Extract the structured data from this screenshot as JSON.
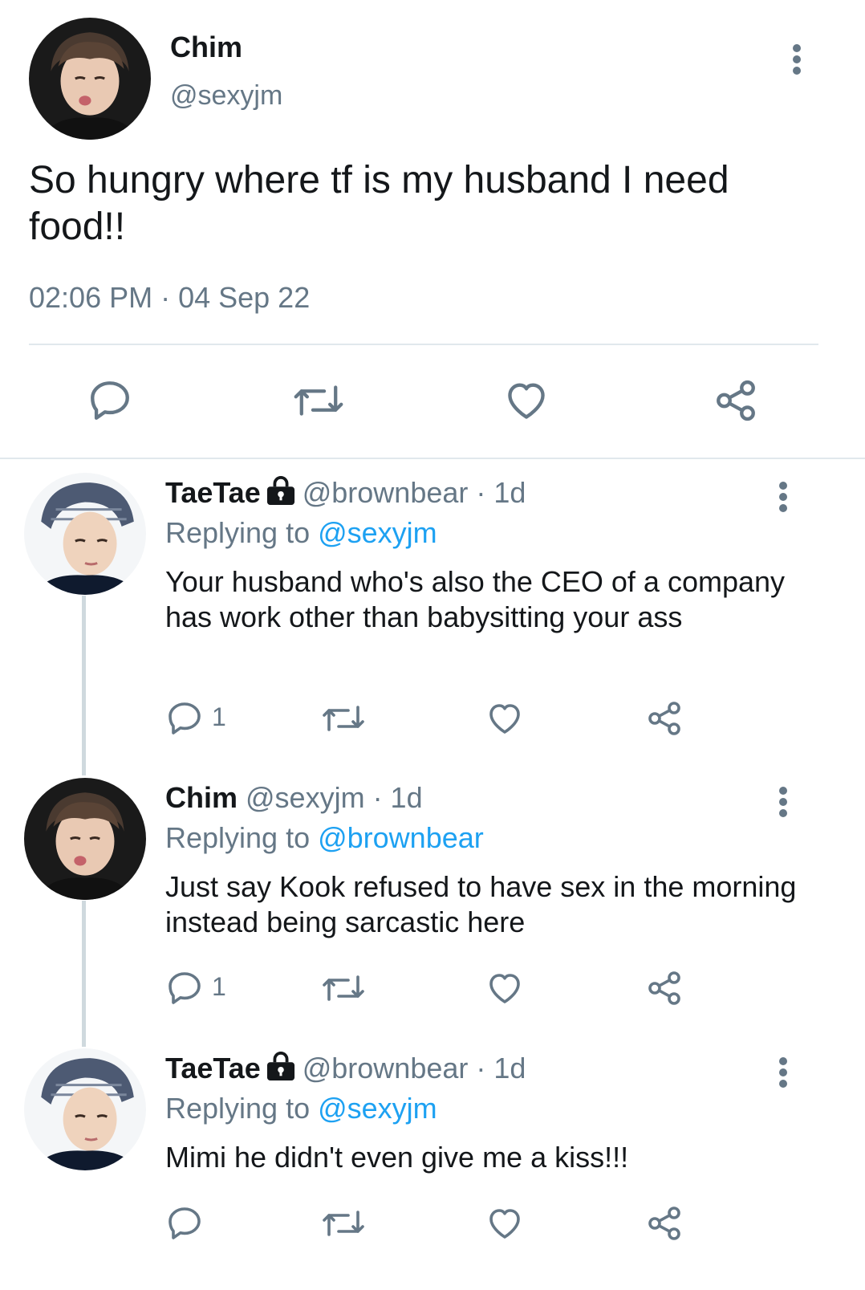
{
  "main_tweet": {
    "author_name": "Chim",
    "author_handle": "@sexyjm",
    "text": "So hungry where tf is my husband I need food!!",
    "timestamp": "02:06 PM · 04 Sep 22",
    "actions": [
      "reply-icon",
      "retweet-icon",
      "like-icon",
      "share-icon"
    ]
  },
  "replies": [
    {
      "name": "TaeTae",
      "protected": true,
      "meta": "@brownbear · 1d",
      "replying_prefix": "Replying to ",
      "replying_to": "@sexyjm",
      "text": "Your husband who's also the CEO of a company has work other than babysitting your ass",
      "reply_count": "1"
    },
    {
      "name": "Chim",
      "protected": false,
      "meta": "@sexyjm · 1d",
      "replying_prefix": "Replying to ",
      "replying_to": "@brownbear",
      "text": "Just say Kook refused to have sex in the morning instead being sarcastic here",
      "reply_count": "1"
    },
    {
      "name": "TaeTae",
      "protected": true,
      "meta": "@brownbear · 1d",
      "replying_prefix": "Replying to ",
      "replying_to": "@sexyjm",
      "text": "Mimi he didn't even give me a kiss!!!",
      "reply_count": ""
    }
  ],
  "colors": {
    "text": "#14171a",
    "secondary": "#657786",
    "link": "#1da1f2",
    "divider": "#e1e8ed"
  }
}
